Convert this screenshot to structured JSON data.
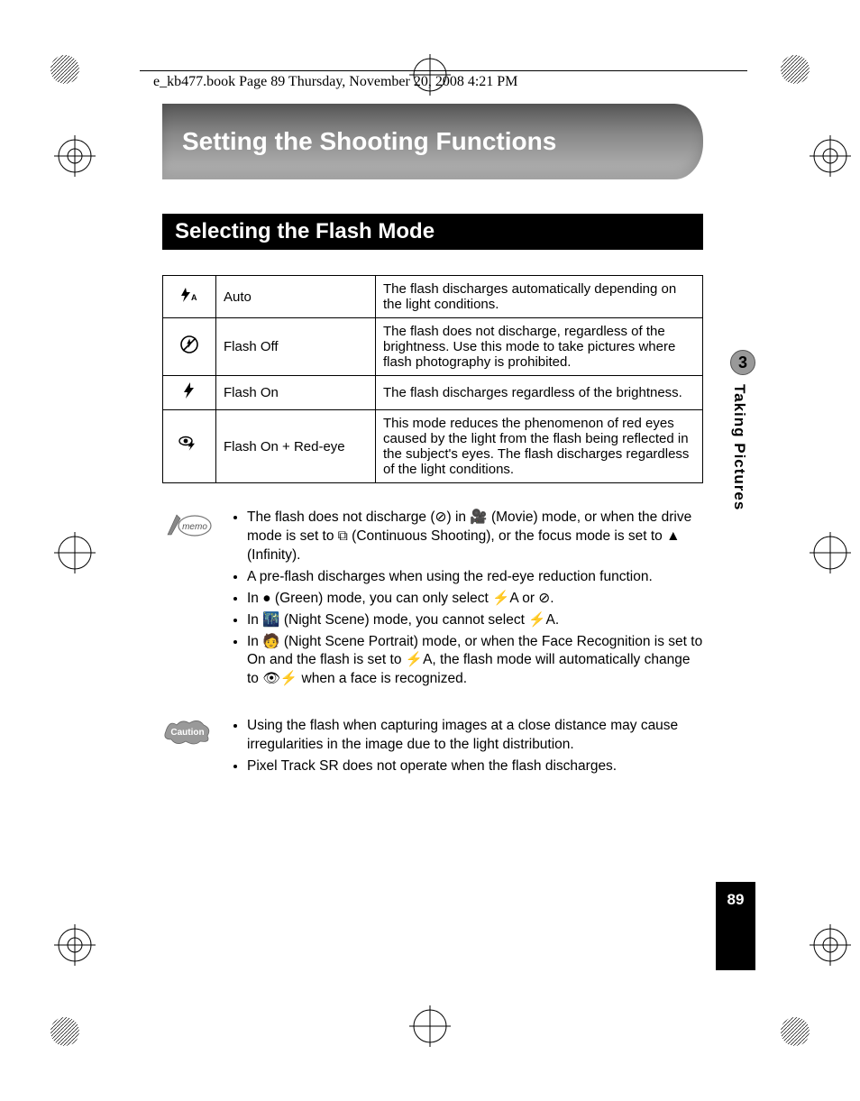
{
  "header_line": "e_kb477.book  Page 89  Thursday, November 20, 2008  4:21 PM",
  "chapter_title": "Setting the Shooting Functions",
  "section_title": "Selecting the Flash Mode",
  "side_tab": {
    "number": "3",
    "label": "Taking Pictures"
  },
  "page_number": "89",
  "table": {
    "rows": [
      {
        "icon": "flash-auto",
        "name": "Auto",
        "desc": "The flash discharges automatically depending on the light conditions."
      },
      {
        "icon": "flash-off",
        "name": "Flash Off",
        "desc": "The flash does not discharge, regardless of the brightness. Use this mode to take pictures where flash photography is prohibited."
      },
      {
        "icon": "flash-on",
        "name": "Flash On",
        "desc": "The flash discharges regardless of the brightness."
      },
      {
        "icon": "flash-redeye",
        "name": "Flash On +  Red-eye",
        "desc": "This mode reduces the phenomenon of red eyes caused by the light from the flash being reflected in the subject's eyes. The flash discharges regardless of the light conditions."
      }
    ]
  },
  "memo": {
    "items": [
      "The flash does not discharge (⊘) in 🎥 (Movie) mode, or when the drive mode is set to ⧉ (Continuous Shooting), or the focus mode is set to ▲ (Infinity).",
      "A pre-flash discharges when using the red-eye reduction function.",
      "In ● (Green) mode, you can only select ⚡A or ⊘.",
      "In 🌃 (Night Scene) mode, you cannot select ⚡A.",
      "In 🧑 (Night Scene Portrait) mode, or when the Face Recognition is set to On and the flash is set to ⚡A, the flash mode will automatically change to 👁⚡ when a face is recognized."
    ]
  },
  "caution": {
    "items": [
      "Using the flash when capturing images at a close distance may cause irregularities in the image due to the light distribution.",
      "Pixel Track SR does not operate when the flash discharges."
    ]
  }
}
